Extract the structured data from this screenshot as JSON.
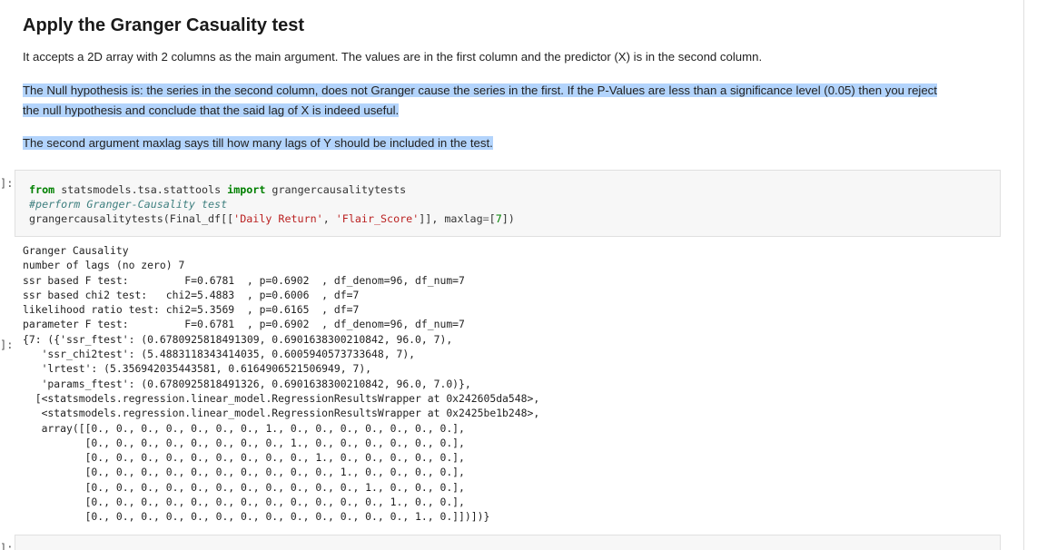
{
  "markdown": {
    "heading": "Apply the Granger Casuality test",
    "para1": "It accepts a 2D array with 2 columns as the main argument. The values are in the first column and the predictor (X) is in the second column.",
    "para2_line1": "The Null hypothesis is: the series in the second column, does not Granger cause the series in the first. If the P-Values are less than a significance level (0.05) then you reject",
    "para2_line2": "the null hypothesis and conclude that the said lag of X is indeed useful.",
    "para3": "The second argument maxlag says till how many lags of Y should be included in the test."
  },
  "cell": {
    "prompt_in": "]:",
    "prompt_out": "]:",
    "prompt_next": "]:",
    "code": {
      "line1_from": "from",
      "line1_module": " statsmodels.tsa.stattools ",
      "line1_import": "import",
      "line1_name": " grangercausalitytests",
      "line2_comment": "#perform Granger-Causality test",
      "line3_func": "grangercausalitytests(Final_df[[",
      "line3_str1": "'Daily Return'",
      "line3_sep": ", ",
      "line3_str2": "'Flair_Score'",
      "line3_mid": "]], maxlag",
      "line3_eq": "=",
      "line3_open": "[",
      "line3_num": "7",
      "line3_close": "])"
    }
  },
  "output": {
    "lines": [
      "Granger Causality",
      "number of lags (no zero) 7",
      "ssr based F test:         F=0.6781  , p=0.6902  , df_denom=96, df_num=7",
      "ssr based chi2 test:   chi2=5.4883  , p=0.6006  , df=7",
      "likelihood ratio test: chi2=5.3569  , p=0.6165  , df=7",
      "parameter F test:         F=0.6781  , p=0.6902  , df_denom=96, df_num=7",
      "{7: ({'ssr_ftest': (0.6780925818491309, 0.6901638300210842, 96.0, 7),",
      "   'ssr_chi2test': (5.4883118343414035, 0.6005940573733648, 7),",
      "   'lrtest': (5.356942035443581, 0.6164906521506949, 7),",
      "   'params_ftest': (0.6780925818491326, 0.6901638300210842, 96.0, 7.0)},",
      "  [<statsmodels.regression.linear_model.RegressionResultsWrapper at 0x242605da548>,",
      "   <statsmodels.regression.linear_model.RegressionResultsWrapper at 0x2425be1b248>,",
      "   array([[0., 0., 0., 0., 0., 0., 0., 1., 0., 0., 0., 0., 0., 0., 0.],",
      "          [0., 0., 0., 0., 0., 0., 0., 0., 1., 0., 0., 0., 0., 0., 0.],",
      "          [0., 0., 0., 0., 0., 0., 0., 0., 0., 1., 0., 0., 0., 0., 0.],",
      "          [0., 0., 0., 0., 0., 0., 0., 0., 0., 0., 1., 0., 0., 0., 0.],",
      "          [0., 0., 0., 0., 0., 0., 0., 0., 0., 0., 0., 1., 0., 0., 0.],",
      "          [0., 0., 0., 0., 0., 0., 0., 0., 0., 0., 0., 0., 1., 0., 0.],",
      "          [0., 0., 0., 0., 0., 0., 0., 0., 0., 0., 0., 0., 0., 1., 0.]])])}"
    ]
  },
  "colors": {
    "selection": "#b3d4fc",
    "code_bg": "#f7f7f7",
    "keyword": "#008000",
    "string": "#ba2121",
    "comment": "#408080"
  }
}
